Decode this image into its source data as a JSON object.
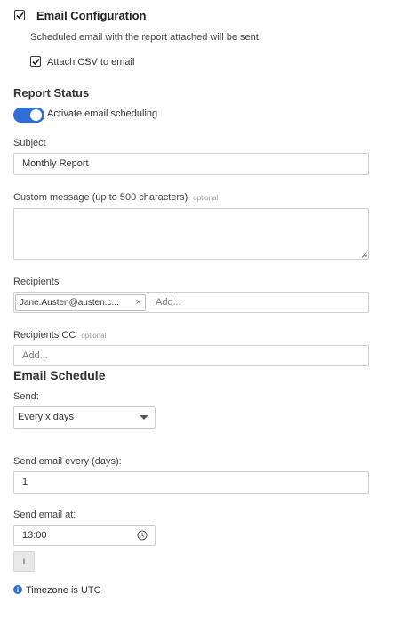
{
  "email_config": {
    "title": "Email Configuration",
    "description": "Scheduled email with the report attached will be sent",
    "attach_csv_label": "Attach CSV to email"
  },
  "report_status": {
    "heading": "Report Status",
    "activate_label": "Activate email scheduling"
  },
  "subject": {
    "label": "Subject",
    "value": "Monthly Report"
  },
  "custom_message": {
    "label": "Custom message (up to 500 characters)",
    "optional": "optional",
    "value": ""
  },
  "recipients": {
    "label": "Recipients",
    "chip": "Jane.Austen@austen.c...",
    "chip_remove": "×",
    "placeholder": "Add..."
  },
  "recipients_cc": {
    "label": "Recipients CC",
    "optional": "optional",
    "placeholder": "Add..."
  },
  "schedule": {
    "heading": "Email Schedule",
    "send_label": "Send:",
    "send_value": "Every x days",
    "every_label": "Send email every (days):",
    "every_value": "1",
    "at_label": "Send email at:",
    "at_value": "13:00",
    "small_button": "ı",
    "timezone_note": "Timezone is UTC"
  },
  "colors": {
    "accent": "#2e6fd6"
  }
}
